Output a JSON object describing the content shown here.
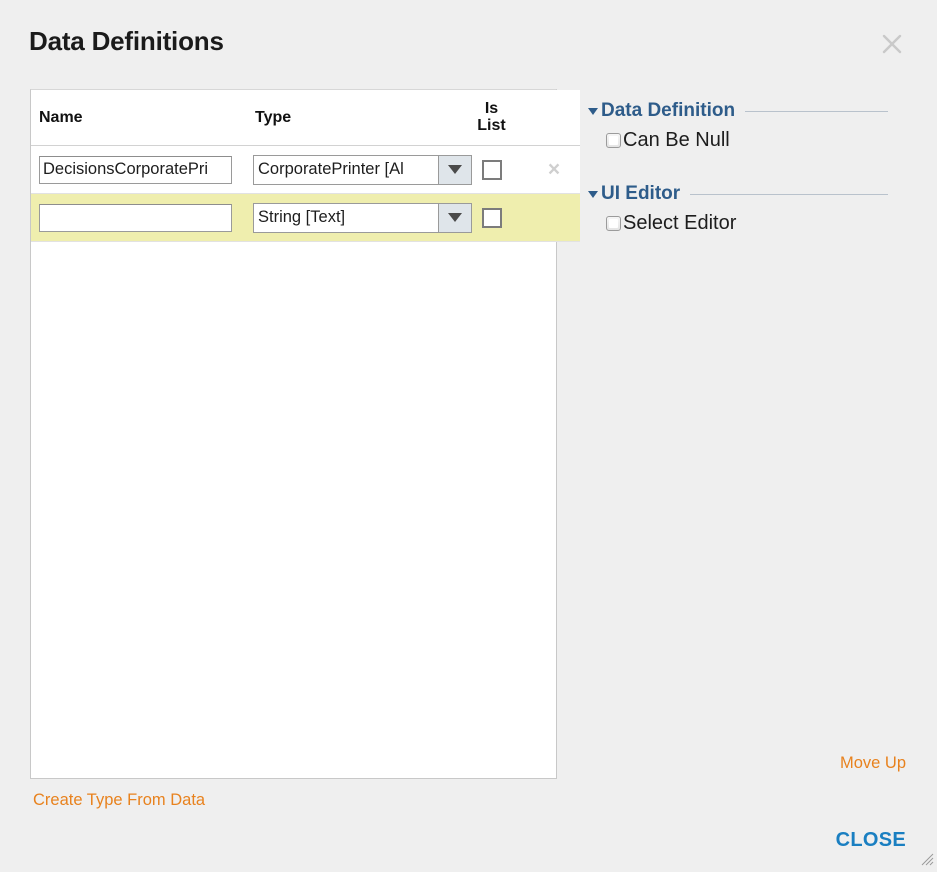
{
  "dialog": {
    "title": "Data Definitions",
    "close_icon": "close-icon"
  },
  "table": {
    "columns": [
      {
        "key": "name",
        "label": "Name"
      },
      {
        "key": "type",
        "label": "Type"
      },
      {
        "key": "islist",
        "label_line1": "Is",
        "label_line2": "List"
      },
      {
        "key": "delete",
        "label": ""
      }
    ],
    "rows": [
      {
        "name_value": "DecisionsCorporatePri",
        "name_placeholder": "",
        "type_value": "CorporatePrinter  [Al",
        "is_list_checked": false,
        "delete_glyph": "×",
        "state": "normal"
      },
      {
        "name_value": "",
        "name_placeholder": "",
        "type_value": "String [Text]",
        "is_list_checked": false,
        "delete_glyph": "",
        "state": "active"
      }
    ]
  },
  "properties": {
    "sections": [
      {
        "title": "Data Definition",
        "expanded": true,
        "items": [
          {
            "label": "Can Be Null",
            "checked": false
          }
        ]
      },
      {
        "title": "UI Editor",
        "expanded": true,
        "items": [
          {
            "label": "Select Editor",
            "checked": false
          }
        ]
      }
    ]
  },
  "footer": {
    "create_type_link": "Create Type From Data",
    "move_up_link": "Move Up",
    "close_button": "CLOSE"
  },
  "colors": {
    "background": "#efefef",
    "panel": "#ffffff",
    "active_row": "#efeeae",
    "section_blue": "#2e5c8a",
    "link_orange": "#e8821e",
    "close_blue": "#1a7fc1",
    "border": "#c8c8c8"
  }
}
